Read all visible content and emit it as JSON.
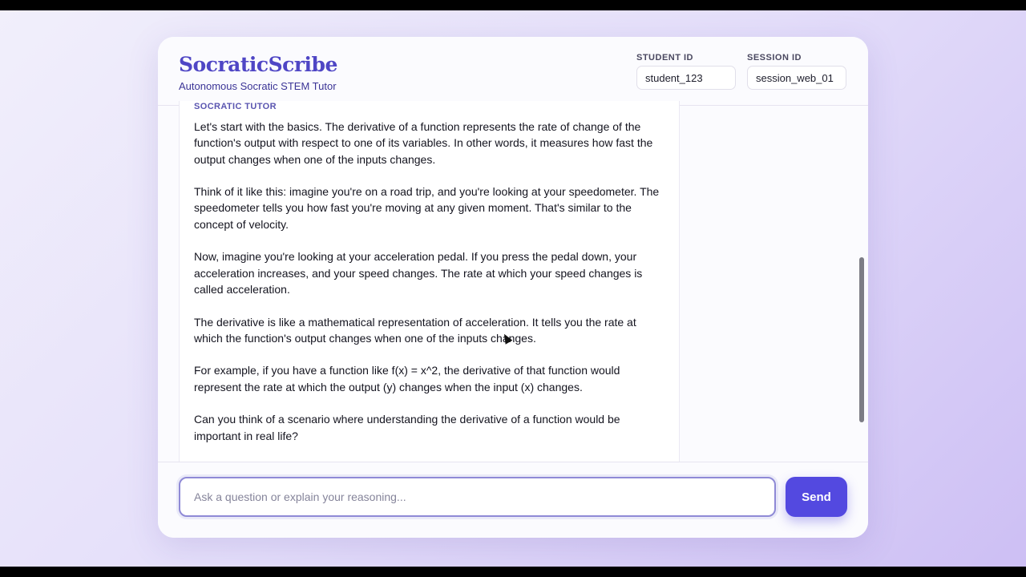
{
  "header": {
    "title": "SocraticScribe",
    "subtitle": "Autonomous Socratic STEM Tutor",
    "student_id": {
      "label": "STUDENT ID",
      "value": "student_123"
    },
    "session_id": {
      "label": "SESSION ID",
      "value": "session_web_01"
    }
  },
  "message": {
    "role": "SOCRATIC TUTOR",
    "paragraphs": [
      "Let's start with the basics. The derivative of a function represents the rate of change of the function's output with respect to one of its variables. In other words, it measures how fast the output changes when one of the inputs changes.",
      "Think of it like this: imagine you're on a road trip, and you're looking at your speedometer. The speedometer tells you how fast you're moving at any given moment. That's similar to the concept of velocity.",
      "Now, imagine you're looking at your acceleration pedal. If you press the pedal down, your acceleration increases, and your speed changes. The rate at which your speed changes is called acceleration.",
      "The derivative is like a mathematical representation of acceleration. It tells you the rate at which the function's output changes when one of the inputs changes.",
      "For example, if you have a function like f(x) = x^2, the derivative of that function would represent the rate at which the output (y) changes when the input (x) changes.",
      "Can you think of a scenario where understanding the derivative of a function would be important in real life?"
    ]
  },
  "composer": {
    "placeholder": "Ask a question or explain your reasoning...",
    "value": "",
    "send_label": "Send"
  },
  "colors": {
    "accent": "#5349e0",
    "brand": "#4f46c5"
  }
}
